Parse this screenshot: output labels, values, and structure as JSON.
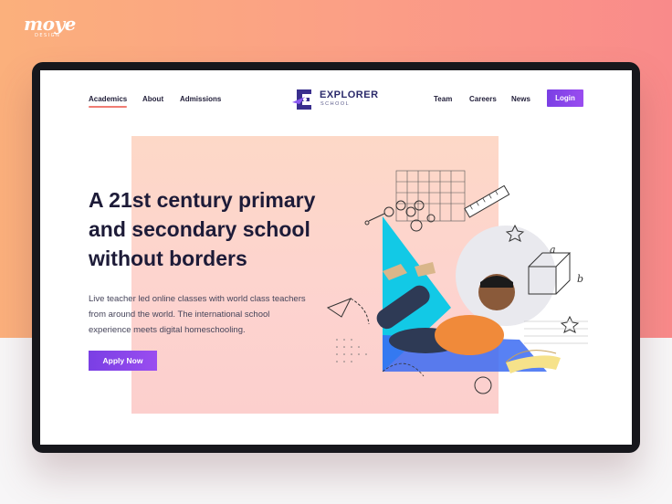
{
  "brand": {
    "name": "moye",
    "sub": "DESIGN"
  },
  "nav": {
    "left": [
      "Academics",
      "About",
      "Admissions"
    ],
    "right": [
      "Team",
      "Careers",
      "News"
    ],
    "login_label": "Login",
    "active": "Academics"
  },
  "logo": {
    "name": "EXPLORER",
    "sub": "SCHOOL"
  },
  "hero": {
    "title_lines": [
      "A 21st century primary",
      "and secondary school",
      "without borders"
    ],
    "description_lines": [
      "Live teacher led online classes with world class teachers",
      "from around the world. The international school",
      "experience meets digital homeschooling."
    ],
    "cta_label": "Apply Now"
  },
  "illustration": {
    "letters": [
      "a",
      "b"
    ]
  },
  "colors": {
    "accent_purple": "#8445EA",
    "underline_coral": "#F07C73",
    "navy_text": "#1D1B38",
    "cyan_shape": "#12C9E6",
    "blue_shape": "#3B6BF2",
    "shirt_orange": "#F08A3A"
  }
}
